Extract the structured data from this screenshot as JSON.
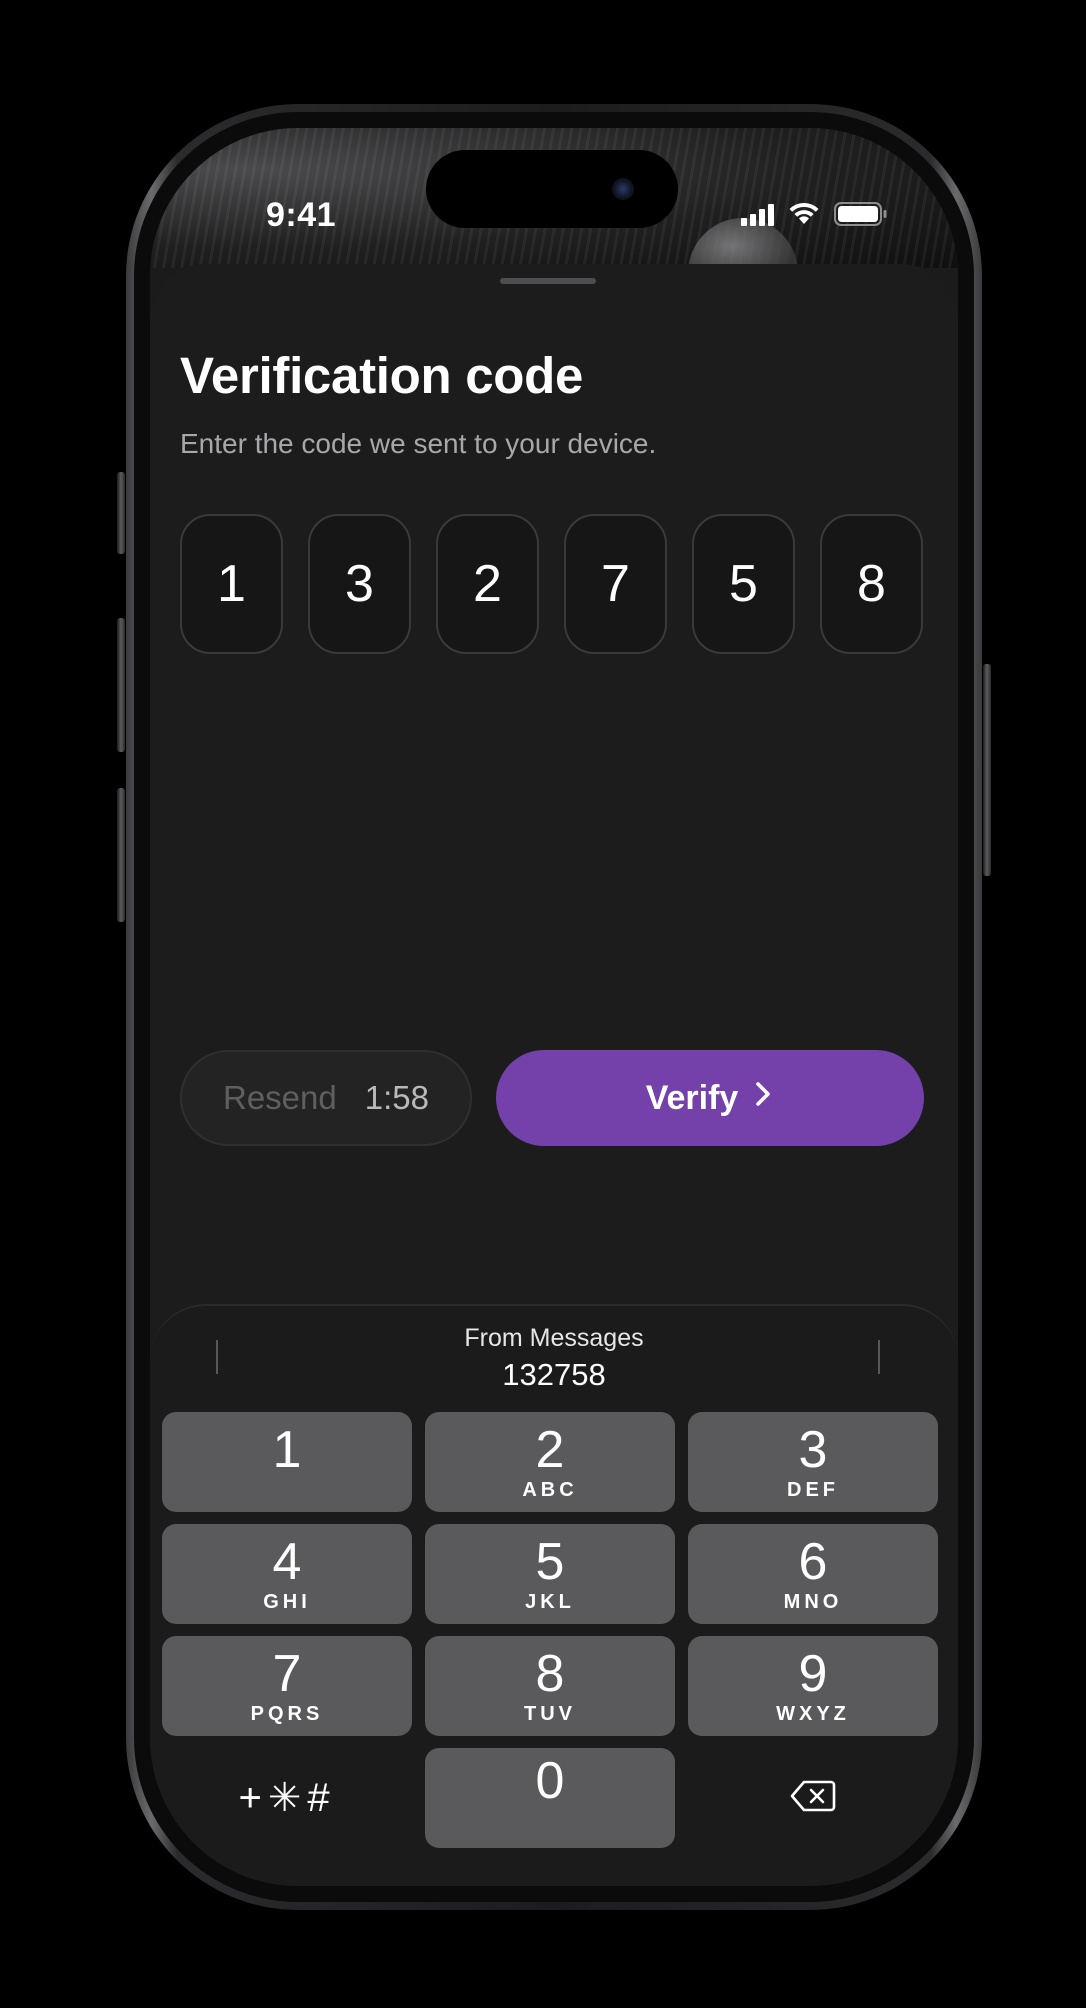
{
  "status_bar": {
    "time": "9:41",
    "signal_icon": "cellular-signal-icon",
    "wifi_icon": "wifi-icon",
    "battery_icon": "battery-icon"
  },
  "sheet": {
    "title": "Verification code",
    "subtitle": "Enter the code we sent to your device.",
    "code_digits": [
      "1",
      "3",
      "2",
      "7",
      "5",
      "8"
    ]
  },
  "actions": {
    "resend_label": "Resend",
    "resend_timer": "1:58",
    "verify_label": "Verify",
    "verify_icon": "chevron-right-icon",
    "accent_color": "#7440a9"
  },
  "keyboard": {
    "suggestion_title": "From Messages",
    "suggestion_code": "132758",
    "keys": [
      {
        "digit": "1",
        "letters": ""
      },
      {
        "digit": "2",
        "letters": "ABC"
      },
      {
        "digit": "3",
        "letters": "DEF"
      },
      {
        "digit": "4",
        "letters": "GHI"
      },
      {
        "digit": "5",
        "letters": "JKL"
      },
      {
        "digit": "6",
        "letters": "MNO"
      },
      {
        "digit": "7",
        "letters": "PQRS"
      },
      {
        "digit": "8",
        "letters": "TUV"
      },
      {
        "digit": "9",
        "letters": "WXYZ"
      }
    ],
    "symbols_label": "+✳#",
    "zero_digit": "0",
    "delete_icon": "backspace-icon"
  }
}
